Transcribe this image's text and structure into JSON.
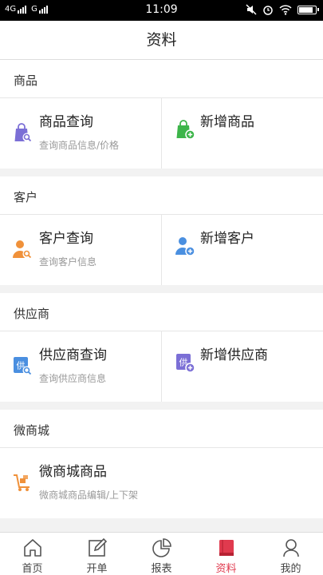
{
  "status_bar": {
    "network_left": "4G",
    "network_right": "G",
    "time": "11:09"
  },
  "navbar": {
    "title": "资料"
  },
  "sections": [
    {
      "header": "商品",
      "items": [
        {
          "title": "商品查询",
          "subtitle": "查询商品信息/价格",
          "icon": "bag-search-icon"
        },
        {
          "title": "新增商品",
          "subtitle": "",
          "icon": "bag-add-icon"
        }
      ]
    },
    {
      "header": "客户",
      "items": [
        {
          "title": "客户查询",
          "subtitle": "查询客户信息",
          "icon": "person-search-icon"
        },
        {
          "title": "新增客户",
          "subtitle": "",
          "icon": "person-add-icon"
        }
      ]
    },
    {
      "header": "供应商",
      "items": [
        {
          "title": "供应商查询",
          "subtitle": "查询供应商信息",
          "icon": "supplier-search-icon",
          "icon_text": "供"
        },
        {
          "title": "新增供应商",
          "subtitle": "",
          "icon": "supplier-add-icon",
          "icon_text": "供"
        }
      ]
    },
    {
      "header": "微商城",
      "items": [
        {
          "title": "微商城商品",
          "subtitle": "微商城商品编辑/上下架",
          "icon": "cart-icon"
        }
      ]
    }
  ],
  "tabs": [
    {
      "label": "首页",
      "icon": "home-icon",
      "active": false
    },
    {
      "label": "开单",
      "icon": "edit-icon",
      "active": false
    },
    {
      "label": "报表",
      "icon": "pie-chart-icon",
      "active": false
    },
    {
      "label": "资料",
      "icon": "book-icon",
      "active": true
    },
    {
      "label": "我的",
      "icon": "user-icon",
      "active": false
    }
  ],
  "colors": {
    "accent": "#e03a4e",
    "purple": "#7b6fd6",
    "green": "#3db54a",
    "orange": "#f0913a",
    "blue": "#4a8fe0"
  }
}
